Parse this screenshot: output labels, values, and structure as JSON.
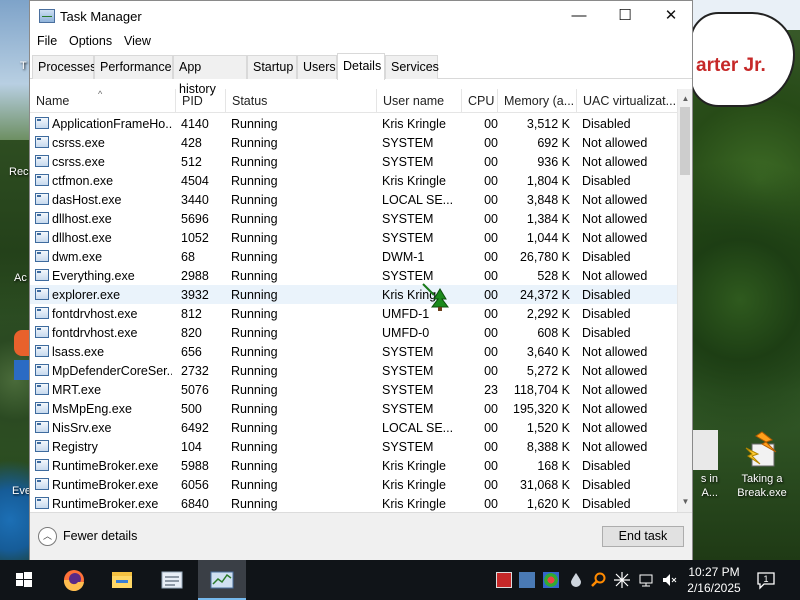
{
  "desktop": {
    "speech_text": "arter Jr.",
    "left_fragments": [
      "T",
      "Rec",
      "Ac",
      "Eve"
    ],
    "icons": [
      {
        "label_line1": "Taking a",
        "label_line2": "Break.exe"
      },
      {
        "label_line1": "s in",
        "label_line2": "A..."
      }
    ]
  },
  "window": {
    "title": "Task Manager",
    "caption": {
      "minimize": "—",
      "maximize": "☐",
      "close": "✕"
    },
    "menu": [
      "File",
      "Options",
      "View"
    ],
    "tabs": [
      "Processes",
      "Performance",
      "App history",
      "Startup",
      "Users",
      "Details",
      "Services"
    ],
    "active_tab": "Details",
    "columns": [
      "Name",
      "PID",
      "Status",
      "User name",
      "CPU",
      "Memory (a...",
      "UAC virtualizat..."
    ],
    "rows": [
      {
        "name": "ApplicationFrameHo...",
        "pid": "4140",
        "status": "Running",
        "user": "Kris Kringle",
        "cpu": "00",
        "mem": "3,512 K",
        "uac": "Disabled"
      },
      {
        "name": "csrss.exe",
        "pid": "428",
        "status": "Running",
        "user": "SYSTEM",
        "cpu": "00",
        "mem": "692 K",
        "uac": "Not allowed"
      },
      {
        "name": "csrss.exe",
        "pid": "512",
        "status": "Running",
        "user": "SYSTEM",
        "cpu": "00",
        "mem": "936 K",
        "uac": "Not allowed"
      },
      {
        "name": "ctfmon.exe",
        "pid": "4504",
        "status": "Running",
        "user": "Kris Kringle",
        "cpu": "00",
        "mem": "1,804 K",
        "uac": "Disabled"
      },
      {
        "name": "dasHost.exe",
        "pid": "3440",
        "status": "Running",
        "user": "LOCAL SE...",
        "cpu": "00",
        "mem": "3,848 K",
        "uac": "Not allowed"
      },
      {
        "name": "dllhost.exe",
        "pid": "5696",
        "status": "Running",
        "user": "SYSTEM",
        "cpu": "00",
        "mem": "1,384 K",
        "uac": "Not allowed"
      },
      {
        "name": "dllhost.exe",
        "pid": "1052",
        "status": "Running",
        "user": "SYSTEM",
        "cpu": "00",
        "mem": "1,044 K",
        "uac": "Not allowed"
      },
      {
        "name": "dwm.exe",
        "pid": "68",
        "status": "Running",
        "user": "DWM-1",
        "cpu": "00",
        "mem": "26,780 K",
        "uac": "Disabled"
      },
      {
        "name": "Everything.exe",
        "pid": "2988",
        "status": "Running",
        "user": "SYSTEM",
        "cpu": "00",
        "mem": "528 K",
        "uac": "Not allowed"
      },
      {
        "name": "explorer.exe",
        "pid": "3932",
        "status": "Running",
        "user": "Kris Kring",
        "cpu": "00",
        "mem": "24,372 K",
        "uac": "Disabled"
      },
      {
        "name": "fontdrvhost.exe",
        "pid": "812",
        "status": "Running",
        "user": "UMFD-1",
        "cpu": "00",
        "mem": "2,292 K",
        "uac": "Disabled"
      },
      {
        "name": "fontdrvhost.exe",
        "pid": "820",
        "status": "Running",
        "user": "UMFD-0",
        "cpu": "00",
        "mem": "608 K",
        "uac": "Disabled"
      },
      {
        "name": "lsass.exe",
        "pid": "656",
        "status": "Running",
        "user": "SYSTEM",
        "cpu": "00",
        "mem": "3,640 K",
        "uac": "Not allowed"
      },
      {
        "name": "MpDefenderCoreSer...",
        "pid": "2732",
        "status": "Running",
        "user": "SYSTEM",
        "cpu": "00",
        "mem": "5,272 K",
        "uac": "Not allowed"
      },
      {
        "name": "MRT.exe",
        "pid": "5076",
        "status": "Running",
        "user": "SYSTEM",
        "cpu": "23",
        "mem": "118,704 K",
        "uac": "Not allowed"
      },
      {
        "name": "MsMpEng.exe",
        "pid": "500",
        "status": "Running",
        "user": "SYSTEM",
        "cpu": "00",
        "mem": "195,320 K",
        "uac": "Not allowed"
      },
      {
        "name": "NisSrv.exe",
        "pid": "6492",
        "status": "Running",
        "user": "LOCAL SE...",
        "cpu": "00",
        "mem": "1,520 K",
        "uac": "Not allowed"
      },
      {
        "name": "Registry",
        "pid": "104",
        "status": "Running",
        "user": "SYSTEM",
        "cpu": "00",
        "mem": "8,388 K",
        "uac": "Not allowed"
      },
      {
        "name": "RuntimeBroker.exe",
        "pid": "5988",
        "status": "Running",
        "user": "Kris Kringle",
        "cpu": "00",
        "mem": "168 K",
        "uac": "Disabled"
      },
      {
        "name": "RuntimeBroker.exe",
        "pid": "6056",
        "status": "Running",
        "user": "Kris Kringle",
        "cpu": "00",
        "mem": "31,068 K",
        "uac": "Disabled"
      },
      {
        "name": "RuntimeBroker.exe",
        "pid": "6840",
        "status": "Running",
        "user": "Kris Kringle",
        "cpu": "00",
        "mem": "1,620 K",
        "uac": "Disabled"
      }
    ],
    "selected_row": 9,
    "footer": {
      "fewer_details": "Fewer details",
      "end_task": "End task"
    }
  },
  "taskbar": {
    "time": "10:27 PM",
    "date": "2/16/2025",
    "apps": [
      "start-icon",
      "firefox-icon",
      "file-explorer-icon",
      "notepad-icon",
      "task-manager-icon"
    ]
  }
}
